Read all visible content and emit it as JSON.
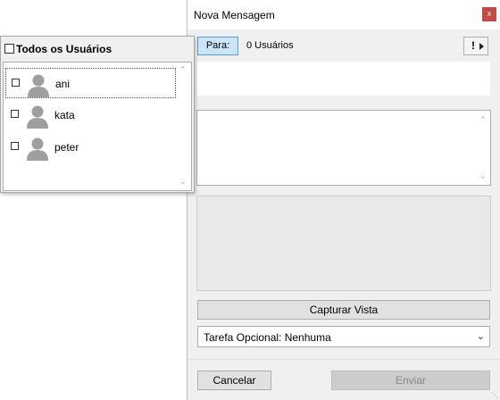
{
  "window": {
    "title": "Nova  Mensagem",
    "close_label": "x",
    "to_button": "Para:",
    "recipient_count": "0 Usuários",
    "priority_label": "!",
    "capture_button": "Capturar Vista",
    "task_select": {
      "selected": "Tarefa Opcional: Nenhuma"
    },
    "cancel_button": "Cancelar",
    "send_button": "Enviar"
  },
  "user_panel": {
    "select_all_label": "Todos os Usuários",
    "users": [
      {
        "name": "ani"
      },
      {
        "name": "kata"
      },
      {
        "name": "peter"
      }
    ]
  },
  "colors": {
    "accent": "#cce4f7",
    "close": "#c74a4a",
    "avatar": "#9e9e9e"
  }
}
